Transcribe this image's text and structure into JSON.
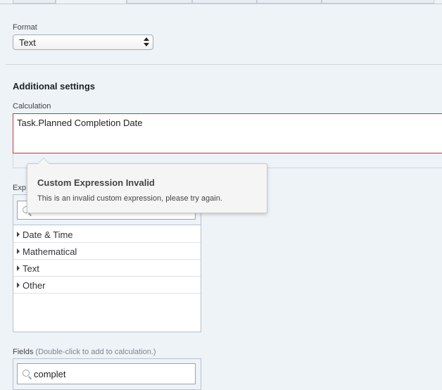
{
  "format": {
    "label": "Format",
    "selected": "Text"
  },
  "additional": {
    "title": "Additional settings",
    "calculation_label": "Calculation",
    "calculation_value": "Task.Planned Completion Date"
  },
  "tooltip": {
    "title": "Custom Expression Invalid",
    "message": "This is an invalid custom expression, please try again."
  },
  "expressions": {
    "label_visible": "Exp",
    "categories": [
      "Date & Time",
      "Mathematical",
      "Text",
      "Other"
    ]
  },
  "fields": {
    "label": "Fields",
    "hint": "(Double-click to add to calculation.)",
    "search_value": "complet"
  },
  "colors": {
    "error_border": "#c8352e",
    "background": "#eef3f8"
  }
}
